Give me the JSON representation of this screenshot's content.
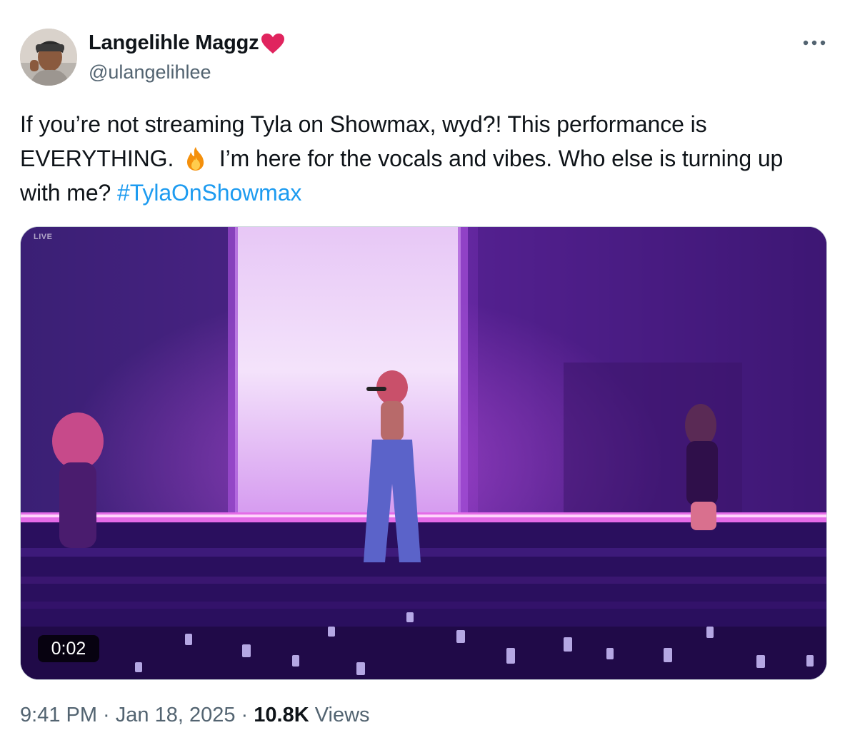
{
  "author": {
    "display_name": "Langelihle Maggz",
    "handle": "@ulangelihlee"
  },
  "tweet": {
    "text_part1": "If you’re not streaming Tyla on Showmax, wyd?! This performance is EVERYTHING.",
    "text_part2": "I’m here for the vocals and vibes. Who else is turning up with me?",
    "hashtag": "#TylaOnShowmax"
  },
  "media": {
    "live_label": "LIVE",
    "duration": "0:02"
  },
  "footer": {
    "time": "9:41 PM",
    "separator1": " · ",
    "date": "Jan 18, 2025",
    "separator2": " · ",
    "views_count": "10.8K",
    "views_label": " Views"
  },
  "colors": {
    "link": "#1d9bf0",
    "secondary_text": "#536471",
    "heart": "#e0245e"
  },
  "icons": [
    "heart-emoji-icon",
    "fire-emoji-icon",
    "more-options-icon"
  ]
}
